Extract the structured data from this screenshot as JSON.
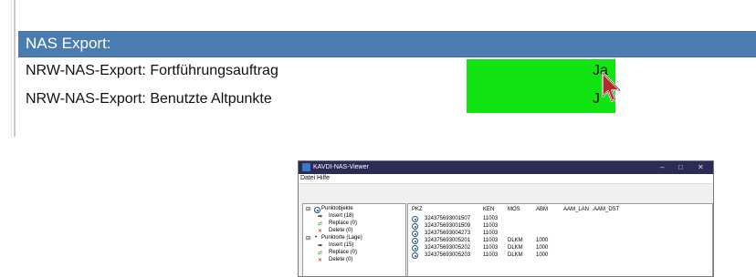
{
  "section": {
    "title": "NAS Export:"
  },
  "rows": [
    {
      "label": "NRW-NAS-Export: Fortführungsauftrag",
      "value": "Ja"
    },
    {
      "label": "NRW-NAS-Export: Benutzte Altpunkte",
      "value": "J"
    }
  ],
  "highlight_color": "#11e511",
  "window": {
    "title": "KAVDI-NAS-Viewer",
    "controls": [
      "–",
      "□",
      "✕"
    ],
    "menu": [
      "Datei",
      "Hilfe"
    ],
    "tree": [
      {
        "label": "Punktobjekte",
        "icon": "radio-icon"
      },
      {
        "label": "Insert (18)",
        "icon": "arrow-icon"
      },
      {
        "label": "Replace (0)",
        "icon": "replace-icon"
      },
      {
        "label": "Delete (0)",
        "icon": "delete-icon"
      },
      {
        "label": "Punktorte (Lage)",
        "icon": "dot-icon"
      },
      {
        "label": "Insert (15)",
        "icon": "arrow-icon"
      },
      {
        "label": "Replace (0)",
        "icon": "replace-icon"
      },
      {
        "label": "Delete (0)",
        "icon": "delete-icon"
      }
    ],
    "columns": [
      "PKZ",
      "KEN",
      "MOS",
      "ABM",
      "AAM_LAN",
      "AAM_DST"
    ],
    "rows": [
      [
        "324375693001507",
        "11003",
        "",
        ""
      ],
      [
        "324375693001509",
        "11003",
        "",
        ""
      ],
      [
        "324375693004273",
        "11003",
        "",
        ""
      ],
      [
        "324375693005201",
        "11003",
        "DLKM",
        "1000"
      ],
      [
        "324375693005202",
        "11003",
        "DLKM",
        "1000"
      ],
      [
        "324375693005203",
        "11003",
        "DLKM",
        "1000"
      ]
    ]
  }
}
